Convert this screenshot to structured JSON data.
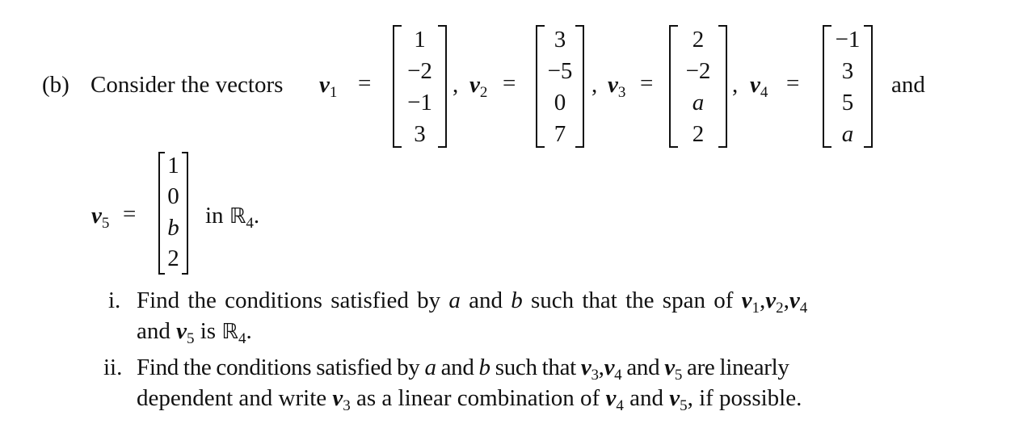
{
  "problem": {
    "label": "(b)",
    "intro": "Consider the vectors",
    "vectors": [
      {
        "name": "v",
        "sub": "1",
        "entries": [
          "1",
          "−2",
          "−1",
          "3"
        ],
        "italic": [
          false,
          false,
          false,
          false
        ]
      },
      {
        "name": "v",
        "sub": "2",
        "entries": [
          "3",
          "−5",
          "0",
          "7"
        ],
        "italic": [
          false,
          false,
          false,
          false
        ]
      },
      {
        "name": "v",
        "sub": "3",
        "entries": [
          "2",
          "−2",
          "a",
          "2"
        ],
        "italic": [
          false,
          false,
          true,
          false
        ]
      },
      {
        "name": "v",
        "sub": "4",
        "entries": [
          "−1",
          "3",
          "5",
          "a"
        ],
        "italic": [
          false,
          false,
          false,
          true
        ]
      },
      {
        "name": "v",
        "sub": "5",
        "entries": [
          "1",
          "0",
          "b",
          "2"
        ],
        "italic": [
          false,
          false,
          true,
          false
        ]
      }
    ],
    "eq": "=",
    "comma": ",",
    "and_word": "and",
    "space_text_pre": "in",
    "space_symbol": "ℝ",
    "space_sub": "4",
    "period": "."
  },
  "parts": [
    {
      "marker": "i.",
      "line1": {
        "t1": "Find the conditions satisfied by",
        "a": "a",
        "t2": "and",
        "b": "b",
        "t3": "such that the span of",
        "v1": "1",
        "v2": "2",
        "v4": "4"
      },
      "line2": {
        "t1": "and",
        "v5": "5",
        "t2": "is",
        "R": "ℝ",
        "Rsub": "4",
        "end": "."
      }
    },
    {
      "marker": "ii.",
      "line1": {
        "t1": "Find the conditions satisfied by",
        "a": "a",
        "t2": "and",
        "b": "b",
        "t3": "such that",
        "v3": "3",
        "v4": "4",
        "t4": "and",
        "v5": "5",
        "t5": "are linearly"
      },
      "line2": {
        "t1": "dependent and write",
        "v3": "3",
        "t2": "as a linear combination of",
        "v4": "4",
        "t3": "and",
        "v5": "5",
        "t4": ", if possible."
      }
    }
  ]
}
